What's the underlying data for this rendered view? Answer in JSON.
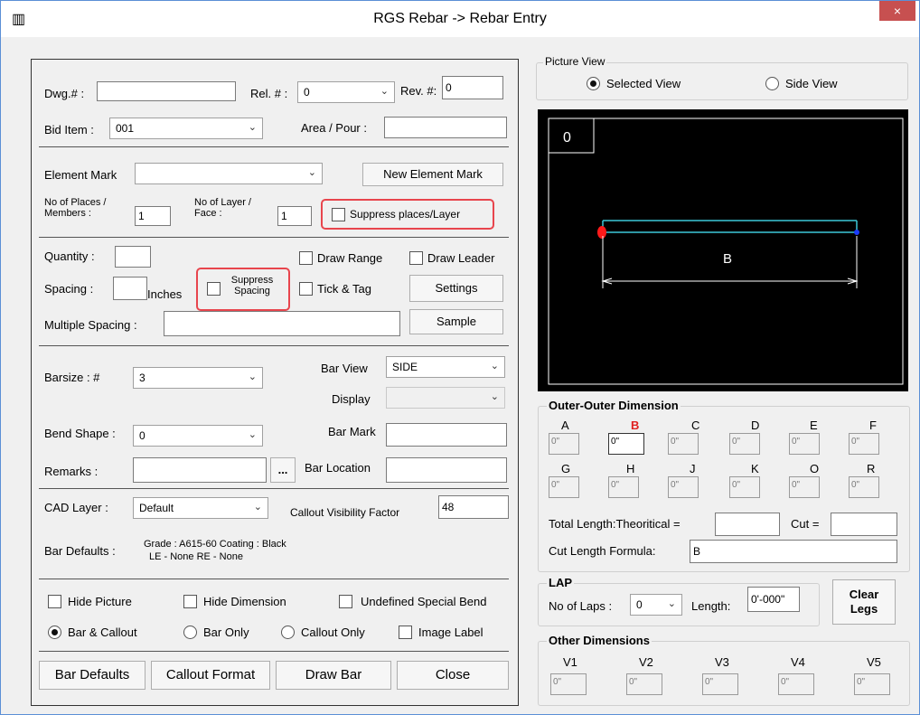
{
  "window": {
    "title": "RGS Rebar -> Rebar Entry",
    "close_glyph": "×",
    "icon_glyph": "▥"
  },
  "form": {
    "dwg_label": "Dwg.# :",
    "dwg_value": "",
    "rel_label": "Rel. # :",
    "rel_value": "0",
    "rev_label": "Rev. #:",
    "rev_value": "0",
    "bid_item_label": "Bid Item :",
    "bid_item_value": "001",
    "area_pour_label": "Area / Pour :",
    "area_pour_value": "",
    "element_mark_label": "Element Mark",
    "element_mark_value": "",
    "new_element_mark_button": "New Element Mark",
    "places_label_1": "No of Places /",
    "places_label_2": "Members   :",
    "places_value": "1",
    "layer_label_1": "No of Layer /",
    "layer_label_2": "Face :",
    "layer_value": "1",
    "suppress_places_label": "Suppress places/Layer",
    "quantity_label": "Quantity :",
    "quantity_value": "",
    "draw_range_label": "Draw Range",
    "draw_leader_label": "Draw Leader",
    "spacing_label": "Spacing :",
    "spacing_value": "",
    "inches_label": "Inches",
    "suppress_spacing_1": "Suppress",
    "suppress_spacing_2": "Spacing",
    "tick_tag_label": "Tick & Tag",
    "settings_button": "Settings",
    "multiple_spacing_label": "Multiple Spacing :",
    "multiple_spacing_value": "",
    "sample_button": "Sample",
    "barsize_label": "Barsize  : #",
    "barsize_value": "3",
    "bar_view_label": "Bar View",
    "bar_view_value": "SIDE",
    "display_label": "Display",
    "display_value": "",
    "bend_shape_label": "Bend Shape :",
    "bend_shape_value": "0",
    "bar_mark_label": "Bar Mark",
    "bar_mark_value": "",
    "remarks_label": "Remarks :",
    "remarks_value": "",
    "ellipsis_button": "...",
    "bar_location_label": "Bar Location",
    "bar_location_value": "",
    "cad_layer_label": "CAD Layer :",
    "cad_layer_value": "Default",
    "callout_visibility_label": "Callout Visibility Factor",
    "callout_visibility_value": "48",
    "bar_defaults_label": "Bar Defaults :",
    "bar_defaults_line1": "Grade : A615-60 Coating : Black",
    "bar_defaults_line2": "LE - None RE - None",
    "hide_picture_label": "Hide Picture",
    "hide_dimension_label": "Hide Dimension",
    "undefined_bend_label": "Undefined Special Bend",
    "bar_callout_label": "Bar & Callout",
    "bar_only_label": "Bar Only",
    "callout_only_label": "Callout Only",
    "image_label_label": "Image Label",
    "btn_bar_defaults": "Bar Defaults",
    "btn_callout_format": "Callout Format",
    "btn_draw_bar": "Draw Bar",
    "btn_close": "Close"
  },
  "picture_view": {
    "legend": "Picture View",
    "selected_view": "Selected View",
    "side_view": "Side View",
    "shape_number": "0",
    "dim_letter": "B",
    "colors": {
      "bar": "#3cc8d8",
      "start_dot": "#ff1a1a",
      "end_dot": "#1a3cff",
      "canvas": "#000000"
    }
  },
  "outer_dim": {
    "legend": "Outer-Outer Dimension",
    "row1": [
      {
        "letter": "A",
        "value": "0\""
      },
      {
        "letter": "B",
        "value": "0\""
      },
      {
        "letter": "C",
        "value": "0\""
      },
      {
        "letter": "D",
        "value": "0\""
      },
      {
        "letter": "E",
        "value": "0\""
      },
      {
        "letter": "F",
        "value": "0\""
      }
    ],
    "row2": [
      {
        "letter": "G",
        "value": "0\""
      },
      {
        "letter": "H",
        "value": "0\""
      },
      {
        "letter": "J",
        "value": "0\""
      },
      {
        "letter": "K",
        "value": "0\""
      },
      {
        "letter": "O",
        "value": "0\""
      },
      {
        "letter": "R",
        "value": "0\""
      }
    ],
    "total_length_label": "Total Length:Theoritical =",
    "total_length_value": "",
    "cut_label": "Cut =",
    "cut_value": "",
    "cut_formula_label": "Cut Length Formula:",
    "cut_formula_value": "B"
  },
  "lap": {
    "legend": "LAP",
    "no_of_laps_label": "No of Laps :",
    "no_of_laps_value": "0",
    "length_label": "Length:",
    "length_value": "0'-000\"",
    "clear_legs_1": "Clear",
    "clear_legs_2": "Legs"
  },
  "other_dim": {
    "legend": "Other Dimensions",
    "items": [
      {
        "label": "V1",
        "value": "0\""
      },
      {
        "label": "V2",
        "value": "0\""
      },
      {
        "label": "V3",
        "value": "0\""
      },
      {
        "label": "V4",
        "value": "0\""
      },
      {
        "label": "V5",
        "value": "0\""
      }
    ]
  }
}
